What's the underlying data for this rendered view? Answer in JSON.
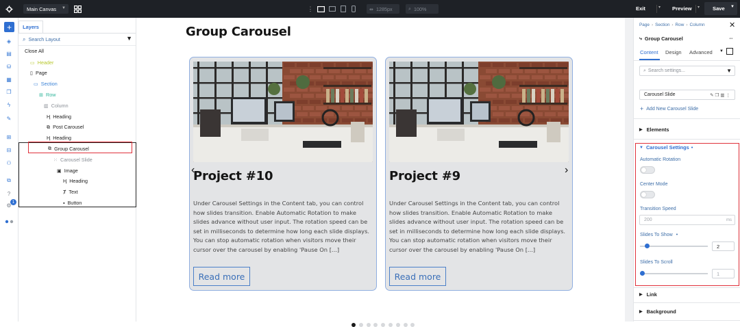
{
  "topbar": {
    "canvas_select": "Main Canvas",
    "width_value": "1285px",
    "zoom_value": "100%",
    "exit_label": "Exit",
    "preview_label": "Preview",
    "save_label": "Save"
  },
  "layers": {
    "tab_label": "Layers",
    "search_placeholder": "Search Layout",
    "close_all": "Close All",
    "tree": [
      {
        "label": "Header",
        "icon": "header-icon",
        "color": "#b7c72b"
      },
      {
        "label": "Page",
        "icon": "page-icon",
        "color": "#222222"
      },
      {
        "label": "Section",
        "icon": "section-icon",
        "color": "#3a82d6"
      },
      {
        "label": "Row",
        "icon": "row-icon",
        "color": "#2fb49a"
      },
      {
        "label": "Column",
        "icon": "column-icon",
        "color": "#8a8f96"
      },
      {
        "label": "Heading",
        "icon": "heading-icon",
        "color": "#222222"
      },
      {
        "label": "Post Carousel",
        "icon": "post-carousel-icon",
        "color": "#222222"
      },
      {
        "label": "Heading",
        "icon": "heading-icon",
        "color": "#222222"
      },
      {
        "label": "Group Carousel",
        "icon": "group-carousel-icon",
        "color": "#222222"
      },
      {
        "label": "Carousel Slide",
        "icon": "carousel-slide-icon",
        "color": "#8a8f96"
      },
      {
        "label": "Image",
        "icon": "image-icon",
        "color": "#222222"
      },
      {
        "label": "Heading",
        "icon": "heading-icon",
        "color": "#222222"
      },
      {
        "label": "Text",
        "icon": "text-icon",
        "color": "#222222"
      },
      {
        "label": "Button",
        "icon": "button-icon",
        "color": "#222222"
      }
    ]
  },
  "leftbar": {
    "badge": "1"
  },
  "canvas": {
    "page_heading": "Group Carousel",
    "cards": [
      {
        "title": "Project #10",
        "text": "Under Carousel Settings in the Content tab, you can control how slides transition. Enable Automatic Rotation to make slides advance without user input. The rotation speed can be set in milliseconds to determine how long each slide displays. You can stop automatic rotation when visitors move their cursor over the carousel by enabling 'Pause On [...]",
        "button": "Read more"
      },
      {
        "title": "Project #9",
        "text": "Under Carousel Settings in the Content tab, you can control how slides transition. Enable Automatic Rotation to make slides advance without user input. The rotation speed can be set in milliseconds to determine how long each slide displays. You can stop automatic rotation when visitors move their cursor over the carousel by enabling 'Pause On [...]",
        "button": "Read more"
      }
    ],
    "pagination_active": 1,
    "pagination_count": 9
  },
  "panel": {
    "breadcrumb": [
      "Page",
      "Section",
      "Row",
      "Column"
    ],
    "module_title": "Group Carousel",
    "tabs": [
      "Content",
      "Design",
      "Advanced"
    ],
    "active_tab": "Content",
    "search_placeholder": "Search settings...",
    "slide_item": "Carousel Slide",
    "add_slide": "Add New Carousel Slide",
    "sections": {
      "elements": "Elements",
      "carousel_settings": "Carousel Settings",
      "link": "Link",
      "background": "Background"
    },
    "fields": {
      "automatic_rotation": {
        "label": "Automatic Rotation",
        "on": false
      },
      "center_mode": {
        "label": "Center Mode",
        "on": false
      },
      "transition_speed": {
        "label": "Transition Speed",
        "placeholder": "200",
        "unit": "ms"
      },
      "slides_to_show": {
        "label": "Slides To Show",
        "value": "2",
        "level": 0.08
      },
      "slides_to_scroll": {
        "label": "Slides To Scroll",
        "value": "1",
        "level": 0
      }
    }
  },
  "colors": {
    "accent": "#2f6fd1",
    "topbar_bg": "#1e2126",
    "highlight": "#e0303a"
  }
}
